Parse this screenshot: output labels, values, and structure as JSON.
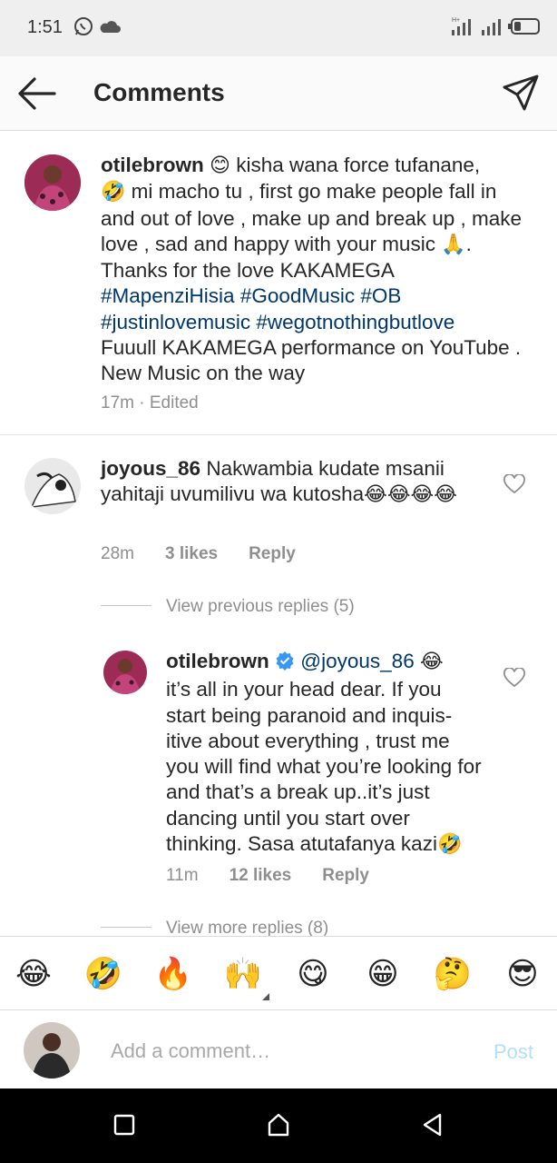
{
  "status_bar": {
    "time": "1:51",
    "icons": [
      "whatsapp-icon",
      "cloud-icon",
      "hplus-signal-icon",
      "signal-icon",
      "battery-icon"
    ],
    "network_label": "H+"
  },
  "header": {
    "title": "Comments",
    "icons": [
      "back-arrow-icon",
      "direct-message-icon"
    ]
  },
  "caption": {
    "username": "otilebrown",
    "text_1": " ",
    "emoji_1": "😊",
    "text_2": " kisha wana force tufanane,",
    "emoji_2": "🤣",
    "text_3": " mi macho tu , first go make people fall in and out of love , make up and break up , make love , sad and happy with your music ",
    "emoji_3": "🙏",
    "text_4": ". Thanks for the love KAKAMEGA ",
    "hashtags_1": "#MapenziHisia #GoodMusic  #OB",
    "hashtags_2": "#justinlovemusic #wegotnothingbutlove",
    "text_5": "Fuuull KAKAMEGA performance on YouTube . New Music on the way",
    "time": "17m",
    "edited": "Edited"
  },
  "comment": {
    "username": "joyous_86",
    "text": " Nakwambia kudate msanii yahitaji uvumilivu wa kutosha",
    "emoji": "😂😂😂😂",
    "time": "28m",
    "likes": "3 likes",
    "reply_label": "Reply",
    "view_previous": "View previous replies (5)"
  },
  "reply": {
    "username": "otilebrown",
    "mention": "@joyous_86",
    "emoji_1": "😂",
    "text": "it’s all in your head dear. If you start being paranoid and inquis-itive about everything , trust me you will find what you’re looking for and that’s a break up..it’s just dancing until you start over thinking. Sasa atutafanya kazi",
    "emoji_2": "🤣",
    "time": "11m",
    "likes": "12 likes",
    "reply_label": "Reply",
    "view_more": "View more replies (8)"
  },
  "emoji_bar": {
    "emojis": [
      "😂",
      "🤣",
      "🔥",
      "🙌",
      "😋",
      "😁",
      "🤔",
      "😎"
    ]
  },
  "composer": {
    "placeholder": "Add a comment…",
    "post_label": "Post"
  },
  "nav_bar": {
    "icons": [
      "recent-apps-icon",
      "home-icon",
      "back-icon"
    ]
  },
  "colors": {
    "hashtag": "#00376b",
    "post_button": "#b2dffc",
    "verified": "#3897f0",
    "secondary_text": "#8e8e8e"
  }
}
